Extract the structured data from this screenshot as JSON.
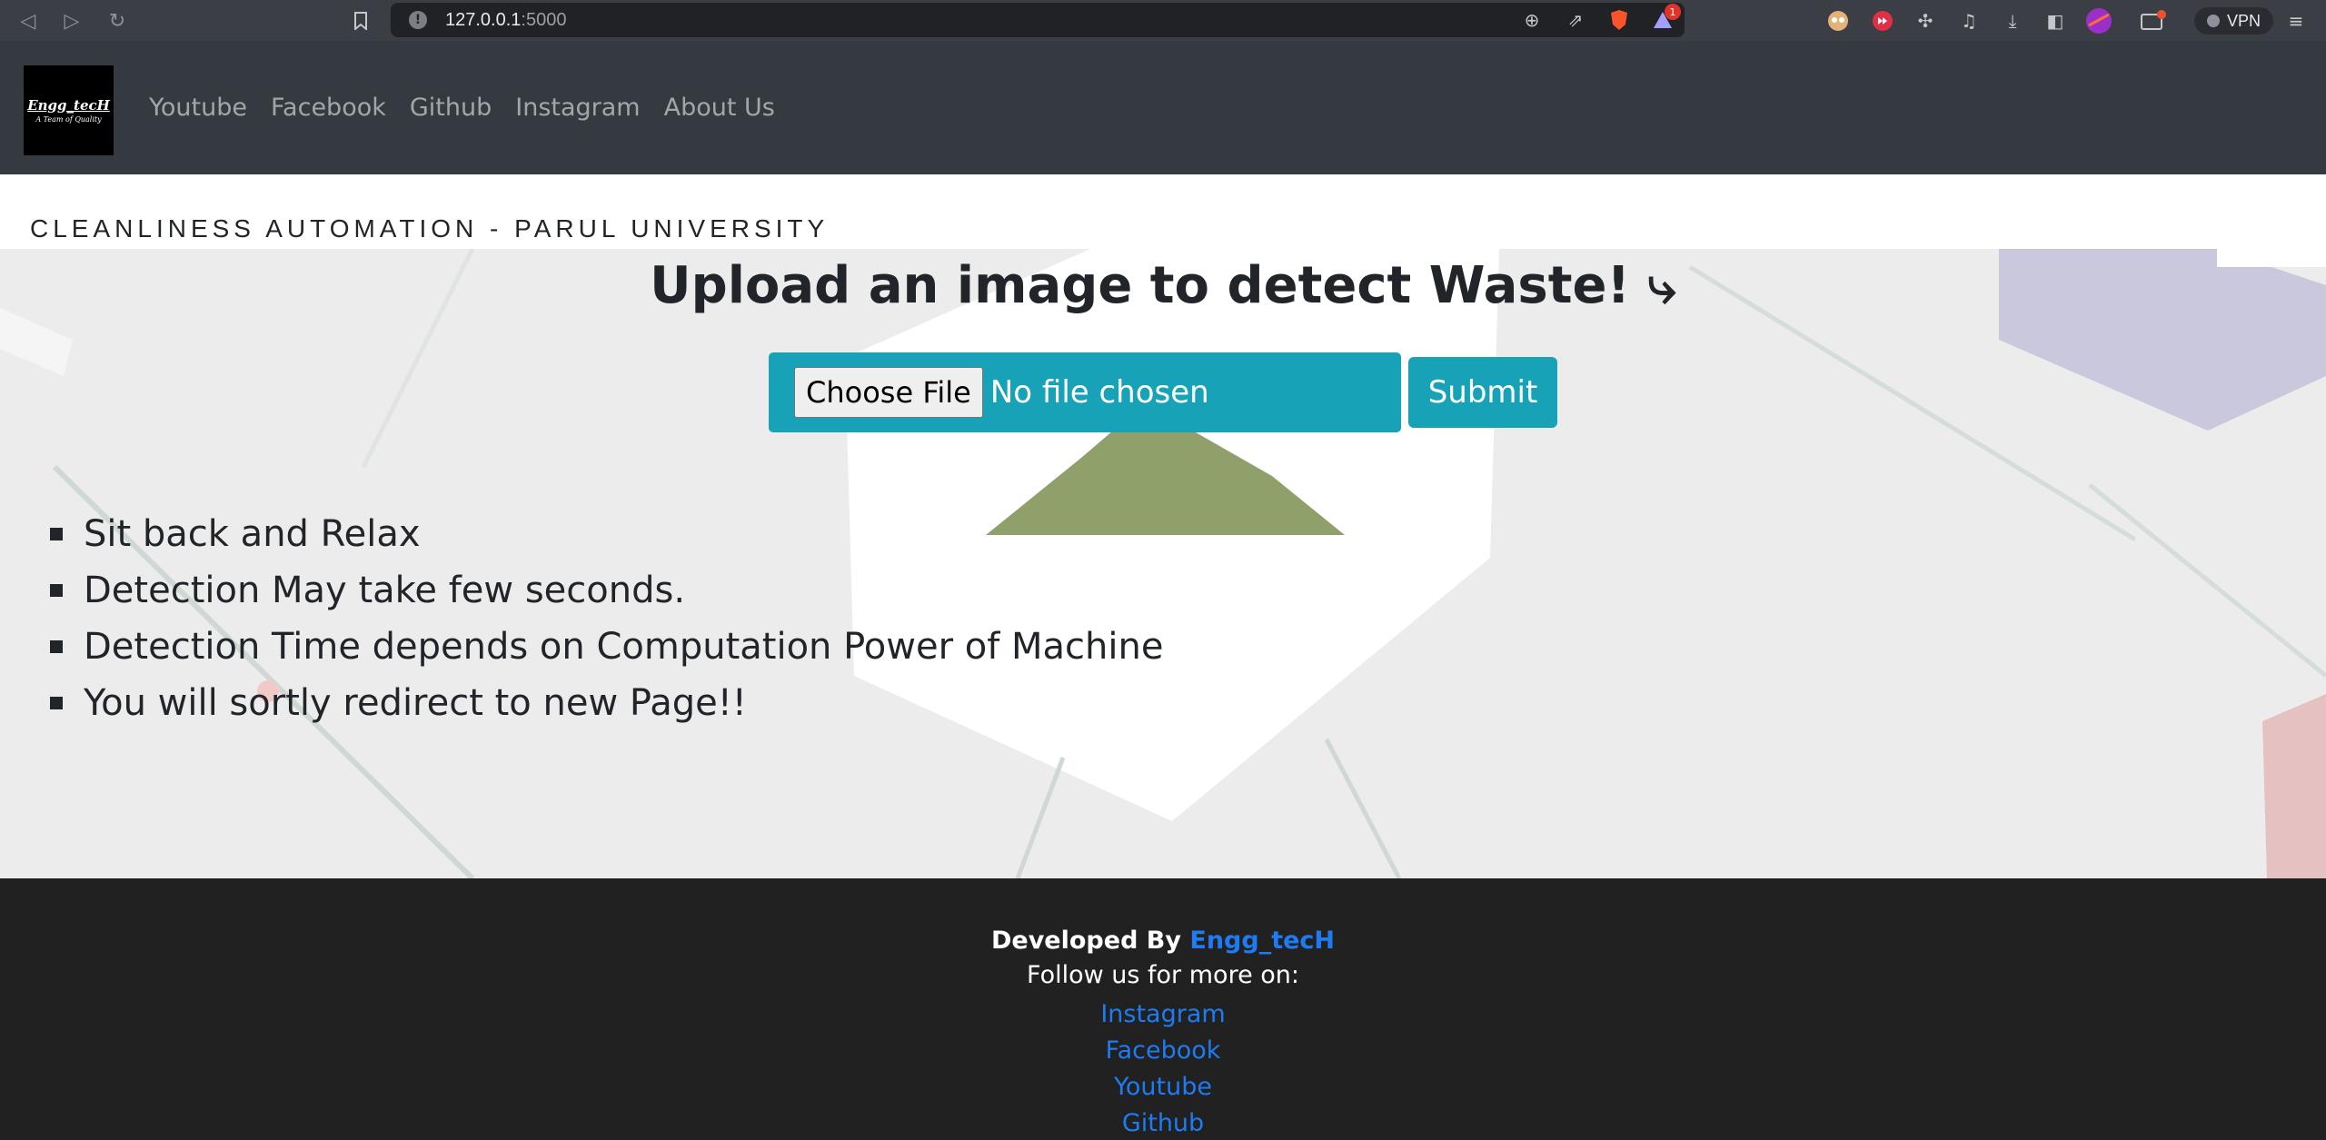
{
  "browser": {
    "url_host": "127.0.0.1",
    "url_port": ":5000",
    "vpn_label": "VPN",
    "notification_count": "1"
  },
  "navbar": {
    "logo_line1": "Engg_tecH",
    "logo_line2": "A Team of Quality",
    "links": [
      "Youtube",
      "Facebook",
      "Github",
      "Instagram",
      "About Us"
    ]
  },
  "main": {
    "site_heading": "CLEANLINESS AUTOMATION - PARUL UNIVERSITY",
    "upload_title": "Upload an image to detect Waste! ⤷",
    "choose_file_label": "Choose File",
    "file_status": "No file chosen",
    "submit_label": "Submit",
    "tips": [
      "Sit back and Relax",
      "Detection May take few seconds.",
      "Detection Time depends on Computation Power of Machine",
      "You will sortly redirect to new Page!!"
    ]
  },
  "footer": {
    "developed_by": "Developed By ",
    "developer_name": "Engg_tecH",
    "follow_text": "Follow us for more on:",
    "links": [
      "Instagram",
      "Facebook",
      "Youtube",
      "Github"
    ]
  },
  "colors": {
    "accent": "#17a2b8",
    "navbar": "#343a40",
    "footer": "#212121",
    "link": "#1e7bf2"
  }
}
